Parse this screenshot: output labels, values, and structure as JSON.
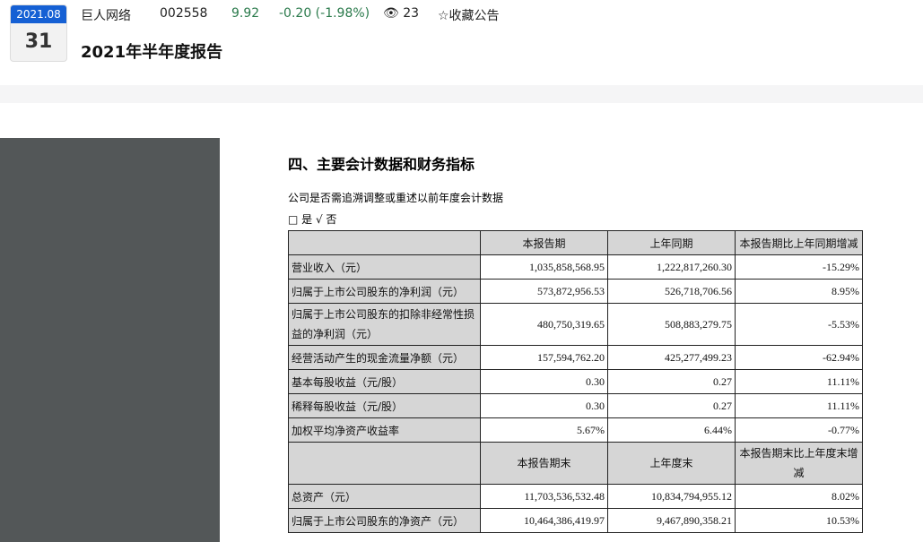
{
  "header": {
    "month": "2021.08",
    "day": "31",
    "company": "巨人网络",
    "code": "002558",
    "price": "9.92",
    "change": "-0.20 (-1.98%)",
    "views": "23",
    "favorite": "☆收藏公告",
    "title": "2021年半年度报告"
  },
  "doc": {
    "section": "四、主要会计数据和财务指标",
    "question": "公司是否需追溯调整或重述以前年度会计数据",
    "answer": "□ 是 √ 否",
    "head1": [
      "",
      "本报告期",
      "上年同期",
      "本报告期比上年同期增减"
    ],
    "rows1": [
      [
        "营业收入（元）",
        "1,035,858,568.95",
        "1,222,817,260.30",
        "-15.29%"
      ],
      [
        "归属于上市公司股东的净利润（元）",
        "573,872,956.53",
        "526,718,706.56",
        "8.95%"
      ],
      [
        "归属于上市公司股东的扣除非经常性损益的净利润（元）",
        "480,750,319.65",
        "508,883,279.75",
        "-5.53%"
      ],
      [
        "经营活动产生的现金流量净额（元）",
        "157,594,762.20",
        "425,277,499.23",
        "-62.94%"
      ],
      [
        "基本每股收益（元/股）",
        "0.30",
        "0.27",
        "11.11%"
      ],
      [
        "稀释每股收益（元/股）",
        "0.30",
        "0.27",
        "11.11%"
      ],
      [
        "加权平均净资产收益率",
        "5.67%",
        "6.44%",
        "-0.77%"
      ]
    ],
    "head2": [
      "",
      "本报告期末",
      "上年度末",
      "本报告期末比上年度末增减"
    ],
    "rows2": [
      [
        "总资产（元）",
        "11,703,536,532.48",
        "10,834,794,955.12",
        "8.02%"
      ],
      [
        "归属于上市公司股东的净资产（元）",
        "10,464,386,419.97",
        "9,467,890,358.21",
        "10.53%"
      ]
    ]
  }
}
